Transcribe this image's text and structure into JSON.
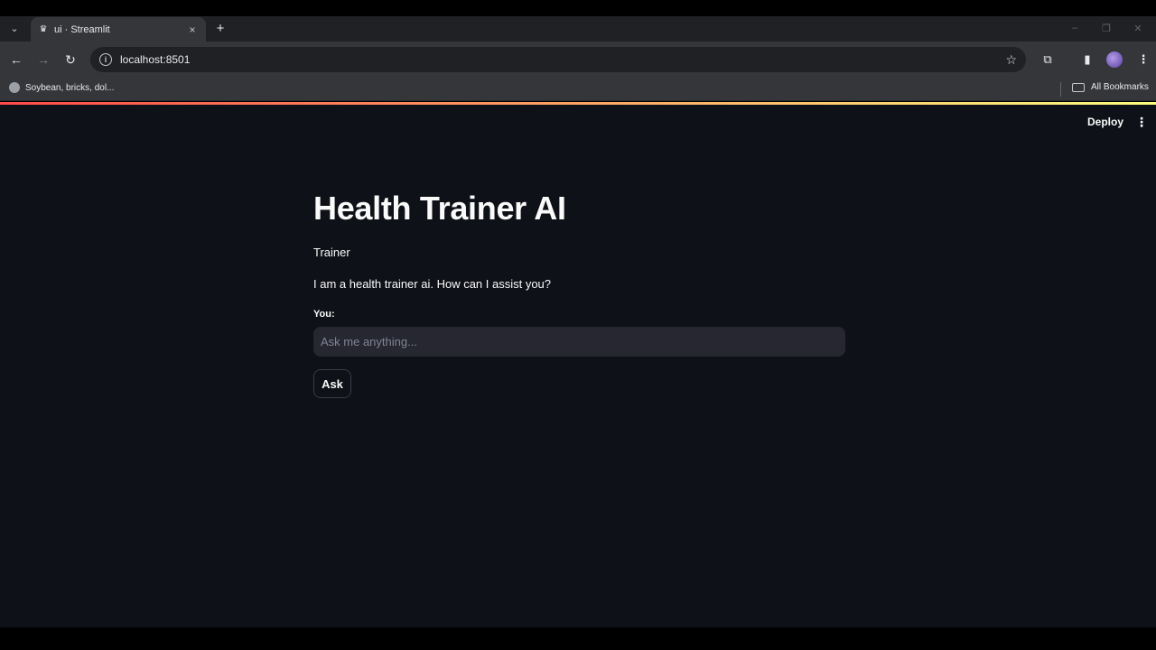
{
  "browser": {
    "tab_list_icon": "chevron-down-icon",
    "tab": {
      "title": "ui · Streamlit",
      "favicon": "streamlit-crown-icon",
      "close": "×"
    },
    "new_tab": "+",
    "window_controls": [
      "–",
      "❐",
      "✕"
    ],
    "nav": {
      "back": "←",
      "forward": "→",
      "reload": "↻"
    },
    "url": "localhost:8501",
    "bookmark_star": "☆",
    "toolbar_icons": [
      "extensions-icon",
      "side-panel-icon",
      "profile-avatar",
      "more-vert-icon"
    ],
    "bookmarks": [
      {
        "label": "Soybean, bricks, dol..."
      }
    ],
    "all_bookmarks_label": "All Bookmarks"
  },
  "app": {
    "accent_colors": [
      "#ff4b4b",
      "#fffd80"
    ],
    "background": "#0e1117",
    "header": {
      "deploy_label": "Deploy",
      "menu_glyph": "⋮"
    },
    "title": "Health Trainer AI",
    "chat": {
      "speaker": "Trainer",
      "message": "I am a health trainer ai. How can I assist you?"
    },
    "input": {
      "label": "You:",
      "placeholder": "Ask me anything...",
      "value": ""
    },
    "ask_button_label": "Ask"
  }
}
